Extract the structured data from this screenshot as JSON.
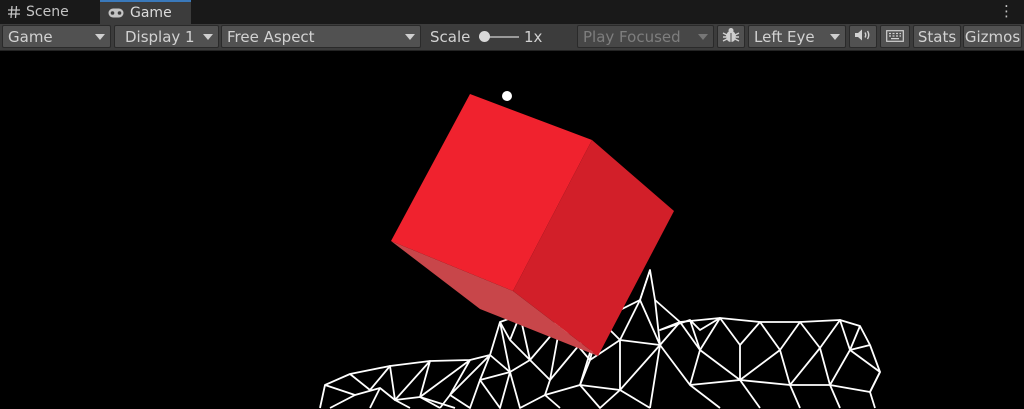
{
  "tabs": [
    {
      "label": "Scene",
      "icon": "hash-icon"
    },
    {
      "label": "Game",
      "icon": "gamepad-icon",
      "active": true
    }
  ],
  "toolbar": {
    "display_mode": "Game",
    "display": "Display 1",
    "aspect": "Free Aspect",
    "scale_label": "Scale",
    "scale_value": "1x",
    "play_mode": "Play Focused",
    "eye": "Left Eye",
    "stats": "Stats",
    "gizmos": "Gizmos",
    "icons": [
      "bug-icon",
      "speaker-icon",
      "keyboard-icon"
    ]
  },
  "colors": {
    "cube_front": "#f0222e",
    "cube_right": "#d21f29",
    "cube_bottom": "#c8464a",
    "wireframe": "#ffffff",
    "accent": "#3a79bb"
  }
}
